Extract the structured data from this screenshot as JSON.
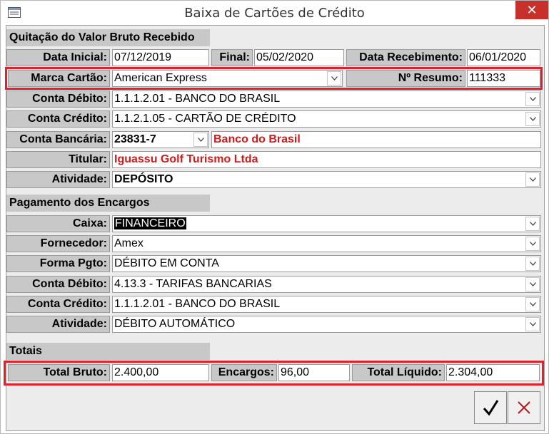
{
  "window": {
    "title": "Baixa de Cartões de Crédito",
    "close_label": "✕"
  },
  "sections": {
    "quitacao": "Quitação do Valor Bruto Recebido",
    "pagamento": "Pagamento dos Encargos",
    "totais": "Totais"
  },
  "quitacao": {
    "data_inicial_label": "Data Inicial:",
    "data_inicial": "07/12/2019",
    "final_label": "Final:",
    "final": "05/02/2020",
    "data_recebimento_label": "Data Recebimento:",
    "data_recebimento": "06/01/2020",
    "marca_cartao_label": "Marca Cartão:",
    "marca_cartao": "American Express",
    "n_resumo_label": "Nº Resumo:",
    "n_resumo": "111333",
    "conta_debito_label": "Conta Débito:",
    "conta_debito": "1.1.1.2.01 - BANCO DO BRASIL",
    "conta_credito_label": "Conta Crédito:",
    "conta_credito": "1.1.2.1.05 - CARTÃO DE CRÉDITO",
    "conta_bancaria_label": "Conta Bancária:",
    "conta_bancaria": "23831-7",
    "banco": "Banco do Brasil",
    "titular_label": "Titular:",
    "titular": "Iguassu Golf Turismo Ltda",
    "atividade_label": "Atividade:",
    "atividade": "DEPÓSITO"
  },
  "pagamento": {
    "caixa_label": "Caixa:",
    "caixa": "FINANCEIRO",
    "fornecedor_label": "Fornecedor:",
    "fornecedor": "Amex",
    "forma_pgto_label": "Forma Pgto:",
    "forma_pgto": "DÉBITO EM CONTA",
    "conta_debito_label": "Conta Débito:",
    "conta_debito": "4.13.3 - TARIFAS BANCARIAS",
    "conta_credito_label": "Conta Crédito:",
    "conta_credito": "1.1.1.2.01 - BANCO DO BRASIL",
    "atividade_label": "Atividade:",
    "atividade": "DÉBITO AUTOMÁTICO"
  },
  "totais": {
    "total_bruto_label": "Total Bruto:",
    "total_bruto": "2.400,00",
    "encargos_label": "Encargos:",
    "encargos": "96,00",
    "total_liquido_label": "Total Líquido:",
    "total_liquido": "2.304,00"
  },
  "colors": {
    "highlight": "#e0202a",
    "red_text": "#d11a1a",
    "close": "#c7302b"
  }
}
